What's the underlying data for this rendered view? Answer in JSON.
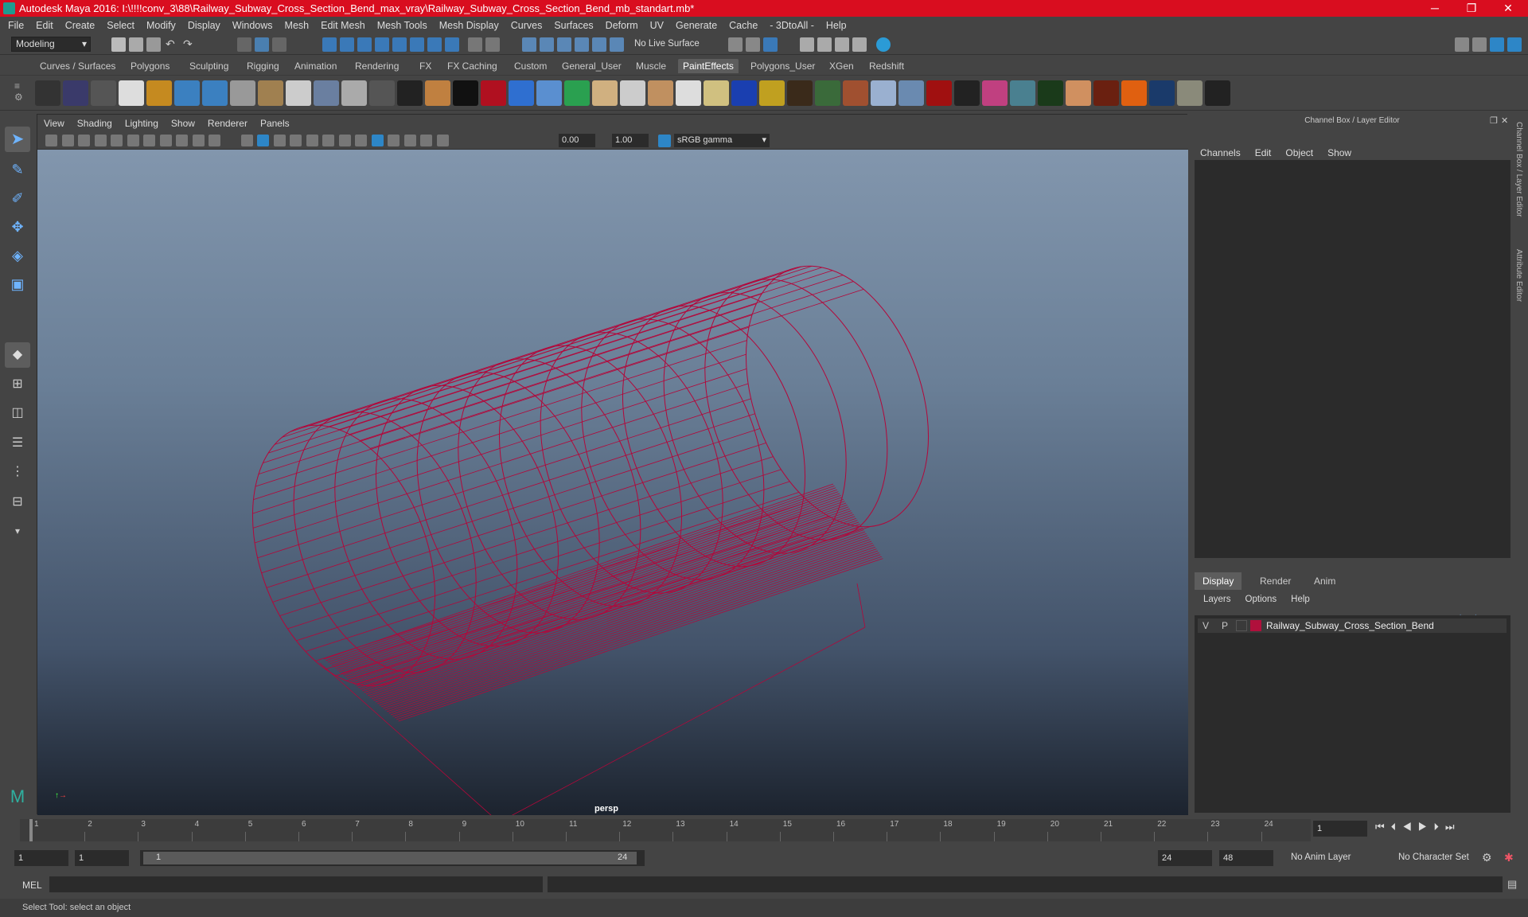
{
  "window": {
    "title": "Autodesk Maya 2016: I:\\!!!!conv_3\\88\\Railway_Subway_Cross_Section_Bend_max_vray\\Railway_Subway_Cross_Section_Bend_mb_standart.mb*",
    "minimize": "─",
    "restore": "❐",
    "close": "✕"
  },
  "menubar": [
    "File",
    "Edit",
    "Create",
    "Select",
    "Modify",
    "Display",
    "Windows",
    "Mesh",
    "Edit Mesh",
    "Mesh Tools",
    "Mesh Display",
    "Curves",
    "Surfaces",
    "Deform",
    "UV",
    "Generate",
    "Cache",
    "- 3DtoAll -",
    "Help"
  ],
  "statusline": {
    "mode": "Modeling",
    "live_surface": "No Live Surface"
  },
  "shelf_tabs": [
    "Curves / Surfaces",
    "Polygons",
    "Sculpting",
    "Rigging",
    "Animation",
    "Rendering",
    "FX",
    "FX Caching",
    "Custom",
    "General_User",
    "Muscle",
    "PaintEffects",
    "Polygons_User",
    "XGen",
    "Redshift"
  ],
  "shelf_active": "PaintEffects",
  "viewport": {
    "menu": [
      "View",
      "Shading",
      "Lighting",
      "Show",
      "Renderer",
      "Panels"
    ],
    "exposure": "0.00",
    "gamma": "1.00",
    "colorspace": "sRGB gamma",
    "camera_label": "persp"
  },
  "channel_box": {
    "header": "Channel Box / Layer Editor",
    "menu": [
      "Channels",
      "Edit",
      "Object",
      "Show"
    ],
    "layer_tabs": [
      "Display",
      "Render",
      "Anim"
    ],
    "layer_menu": [
      "Layers",
      "Options",
      "Help"
    ],
    "layer": {
      "v": "V",
      "p": "P",
      "name": "Railway_Subway_Cross_Section_Bend",
      "color": "#b0103c"
    }
  },
  "side_tabs": [
    "Channel Box / Layer Editor",
    "Attribute Editor"
  ],
  "timeline": {
    "ticks": [
      "1",
      "2",
      "3",
      "4",
      "5",
      "6",
      "7",
      "8",
      "9",
      "10",
      "11",
      "12",
      "13",
      "14",
      "15",
      "16",
      "17",
      "18",
      "19",
      "20",
      "21",
      "22",
      "23",
      "24"
    ],
    "current_frame": "1"
  },
  "range": {
    "start": "1",
    "start_inner": "1",
    "slider_start": "1",
    "slider_end": "24",
    "end_inner": "24",
    "end": "48",
    "anim_layer": "No Anim Layer",
    "character_set": "No Character Set"
  },
  "cmdline": {
    "label": "MEL"
  },
  "helpline": {
    "text": "Select Tool: select an object"
  },
  "colors": {
    "wire": "#b3073a",
    "title": "#d90d1f",
    "bg": "#444444"
  }
}
